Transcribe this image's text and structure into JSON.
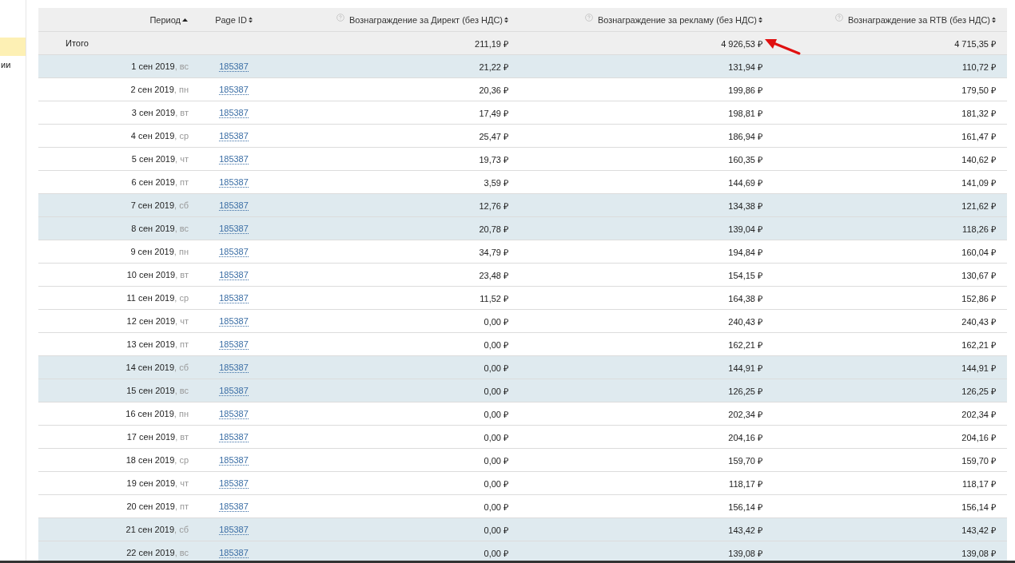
{
  "sidebar": {
    "items": [
      {
        "selected": true
      },
      {
        "label": "ии",
        "selected": false
      }
    ]
  },
  "table": {
    "columns": [
      {
        "label": "Период",
        "help": false,
        "sorted": true
      },
      {
        "label": "Page ID",
        "help": false,
        "sorted": false
      },
      {
        "label": "Вознаграждение за Директ (без НДС)",
        "help": true,
        "sorted": false
      },
      {
        "label": "Вознаграждение за рекламу (без НДС)",
        "help": true,
        "sorted": false
      },
      {
        "label": "Вознаграждение за RTB (без НДС)",
        "help": true,
        "sorted": false
      }
    ],
    "total": {
      "label": "Итого",
      "direct": "211,19 ₽",
      "ads": "4 926,53 ₽",
      "rtb": "4 715,35 ₽"
    },
    "rows": [
      {
        "date": "1 сен 2019",
        "weekday": ", вс",
        "page_id": "185387",
        "direct": "21,22 ₽",
        "ads": "131,94 ₽",
        "rtb": "110,72 ₽",
        "weekend": true
      },
      {
        "date": "2 сен 2019",
        "weekday": ", пн",
        "page_id": "185387",
        "direct": "20,36 ₽",
        "ads": "199,86 ₽",
        "rtb": "179,50 ₽",
        "weekend": false
      },
      {
        "date": "3 сен 2019",
        "weekday": ", вт",
        "page_id": "185387",
        "direct": "17,49 ₽",
        "ads": "198,81 ₽",
        "rtb": "181,32 ₽",
        "weekend": false
      },
      {
        "date": "4 сен 2019",
        "weekday": ", ср",
        "page_id": "185387",
        "direct": "25,47 ₽",
        "ads": "186,94 ₽",
        "rtb": "161,47 ₽",
        "weekend": false
      },
      {
        "date": "5 сен 2019",
        "weekday": ", чт",
        "page_id": "185387",
        "direct": "19,73 ₽",
        "ads": "160,35 ₽",
        "rtb": "140,62 ₽",
        "weekend": false
      },
      {
        "date": "6 сен 2019",
        "weekday": ", пт",
        "page_id": "185387",
        "direct": "3,59 ₽",
        "ads": "144,69 ₽",
        "rtb": "141,09 ₽",
        "weekend": false
      },
      {
        "date": "7 сен 2019",
        "weekday": ", сб",
        "page_id": "185387",
        "direct": "12,76 ₽",
        "ads": "134,38 ₽",
        "rtb": "121,62 ₽",
        "weekend": true
      },
      {
        "date": "8 сен 2019",
        "weekday": ", вс",
        "page_id": "185387",
        "direct": "20,78 ₽",
        "ads": "139,04 ₽",
        "rtb": "118,26 ₽",
        "weekend": true
      },
      {
        "date": "9 сен 2019",
        "weekday": ", пн",
        "page_id": "185387",
        "direct": "34,79 ₽",
        "ads": "194,84 ₽",
        "rtb": "160,04 ₽",
        "weekend": false
      },
      {
        "date": "10 сен 2019",
        "weekday": ", вт",
        "page_id": "185387",
        "direct": "23,48 ₽",
        "ads": "154,15 ₽",
        "rtb": "130,67 ₽",
        "weekend": false
      },
      {
        "date": "11 сен 2019",
        "weekday": ", ср",
        "page_id": "185387",
        "direct": "11,52 ₽",
        "ads": "164,38 ₽",
        "rtb": "152,86 ₽",
        "weekend": false
      },
      {
        "date": "12 сен 2019",
        "weekday": ", чт",
        "page_id": "185387",
        "direct": "0,00 ₽",
        "ads": "240,43 ₽",
        "rtb": "240,43 ₽",
        "weekend": false
      },
      {
        "date": "13 сен 2019",
        "weekday": ", пт",
        "page_id": "185387",
        "direct": "0,00 ₽",
        "ads": "162,21 ₽",
        "rtb": "162,21 ₽",
        "weekend": false
      },
      {
        "date": "14 сен 2019",
        "weekday": ", сб",
        "page_id": "185387",
        "direct": "0,00 ₽",
        "ads": "144,91 ₽",
        "rtb": "144,91 ₽",
        "weekend": true
      },
      {
        "date": "15 сен 2019",
        "weekday": ", вс",
        "page_id": "185387",
        "direct": "0,00 ₽",
        "ads": "126,25 ₽",
        "rtb": "126,25 ₽",
        "weekend": true
      },
      {
        "date": "16 сен 2019",
        "weekday": ", пн",
        "page_id": "185387",
        "direct": "0,00 ₽",
        "ads": "202,34 ₽",
        "rtb": "202,34 ₽",
        "weekend": false
      },
      {
        "date": "17 сен 2019",
        "weekday": ", вт",
        "page_id": "185387",
        "direct": "0,00 ₽",
        "ads": "204,16 ₽",
        "rtb": "204,16 ₽",
        "weekend": false
      },
      {
        "date": "18 сен 2019",
        "weekday": ", ср",
        "page_id": "185387",
        "direct": "0,00 ₽",
        "ads": "159,70 ₽",
        "rtb": "159,70 ₽",
        "weekend": false
      },
      {
        "date": "19 сен 2019",
        "weekday": ", чт",
        "page_id": "185387",
        "direct": "0,00 ₽",
        "ads": "118,17 ₽",
        "rtb": "118,17 ₽",
        "weekend": false
      },
      {
        "date": "20 сен 2019",
        "weekday": ", пт",
        "page_id": "185387",
        "direct": "0,00 ₽",
        "ads": "156,14 ₽",
        "rtb": "156,14 ₽",
        "weekend": false
      },
      {
        "date": "21 сен 2019",
        "weekday": ", сб",
        "page_id": "185387",
        "direct": "0,00 ₽",
        "ads": "143,42 ₽",
        "rtb": "143,42 ₽",
        "weekend": true
      },
      {
        "date": "22 сен 2019",
        "weekday": ", вс",
        "page_id": "185387",
        "direct": "0,00 ₽",
        "ads": "139,08 ₽",
        "rtb": "139,08 ₽",
        "weekend": true
      }
    ]
  }
}
